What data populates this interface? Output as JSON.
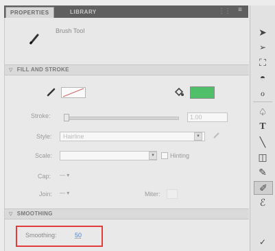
{
  "tabs": [
    {
      "label": "PROPERTIES",
      "active": true
    },
    {
      "label": "LIBRARY",
      "active": false
    }
  ],
  "tool": {
    "name": "Brush Tool",
    "icon": "brush-icon"
  },
  "fill_and_stroke": {
    "header": "FILL AND STROKE",
    "stroke_label": "Stroke:",
    "stroke_value": "1.00",
    "style_label": "Style:",
    "style_value": "Hairline",
    "scale_label": "Scale:",
    "scale_value": "",
    "hinting_label": "Hinting",
    "cap_label": "Cap:",
    "join_label": "Join:",
    "miter_label": "Miter:",
    "fill_color": "#4fbf6a"
  },
  "smoothing": {
    "header": "SMOOTHING",
    "label": "Smoothing:",
    "value": "50"
  },
  "toolbar": {
    "tools": [
      "selection-icon",
      "subselection-icon",
      "free-transform-icon",
      "3d-rotation-icon",
      "lasso-icon",
      "pen-icon",
      "text-icon",
      "line-icon",
      "rectangle-icon",
      "pencil-icon",
      "brush-icon",
      "deco-icon",
      "bone-icon"
    ],
    "selected": "brush-icon"
  }
}
